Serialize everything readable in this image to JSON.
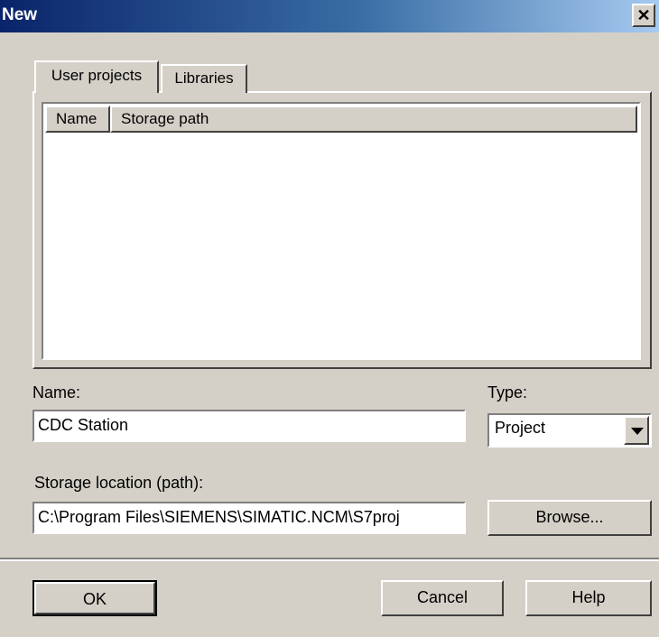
{
  "window": {
    "title": "New",
    "close_label": "✕"
  },
  "tabs": [
    {
      "label": "User projects",
      "active": true
    },
    {
      "label": "Libraries",
      "active": false
    }
  ],
  "list": {
    "columns": [
      "Name",
      "Storage path"
    ],
    "rows": []
  },
  "form": {
    "name_label": "Name:",
    "name_value": "CDC Station",
    "type_label": "Type:",
    "type_value": "Project",
    "storage_label": "Storage location (path):",
    "storage_value": "C:\\Program Files\\SIEMENS\\SIMATIC.NCM\\S7proj",
    "browse_label": "Browse..."
  },
  "buttons": {
    "ok_label": "OK",
    "cancel_label": "Cancel",
    "help_label": "Help"
  },
  "colors": {
    "titlebar_start": "#0a246a",
    "titlebar_end": "#a6caf0",
    "face": "#d4d0c8"
  }
}
